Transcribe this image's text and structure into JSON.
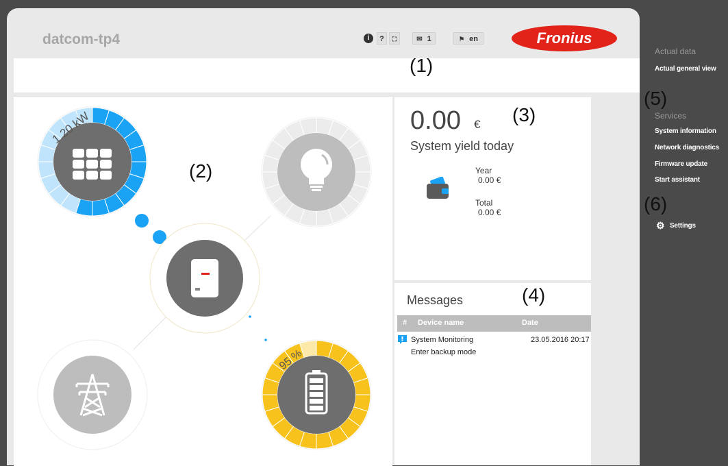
{
  "header": {
    "device_name": "datcom-tp4",
    "info_btn": "i",
    "help_btn": "?",
    "expand_btn": "⛶",
    "mail_count": "1",
    "language": "en",
    "logo_text": "Fronius"
  },
  "annotations": {
    "a1": "(1)",
    "a2": "(2)",
    "a3": "(3)",
    "a4": "(4)",
    "a5": "(5)",
    "a6": "(6)"
  },
  "flow": {
    "pv_power": "1.20 kW",
    "pv_fill_fraction": 0.55,
    "battery_soc": "95 %",
    "battery_fill_fraction": 0.95,
    "icons": [
      "solar-panel-icon",
      "light-bulb-icon",
      "inverter-icon",
      "power-pylon-icon",
      "battery-icon"
    ]
  },
  "yield": {
    "value": "0.00",
    "currency": "€",
    "label": "System yield today",
    "year_label": "Year",
    "year_value": "0.00 €",
    "total_label": "Total",
    "total_value": "0.00 €"
  },
  "messages": {
    "title": "Messages",
    "col_num": "#",
    "col_device": "Device name",
    "col_date": "Date",
    "rows": [
      {
        "device": "System Monitoring",
        "date": "23.05.2016 20:17",
        "text": "Enter backup mode"
      }
    ]
  },
  "sidebar": {
    "actual_data_heading": "Actual data",
    "actual_general_view": "Actual general view",
    "services_heading": "Services",
    "system_information": "System information",
    "network_diagnostics": "Network diagnostics",
    "firmware_update": "Firmware update",
    "start_assistant": "Start assistant",
    "settings": "Settings"
  },
  "colors": {
    "pv_blue": "#1aa3f5",
    "pv_light_blue": "#bfe4fb",
    "battery_yellow": "#f7c21b",
    "battery_light": "#fce9a9",
    "icon_dark": "#6e6e6e",
    "icon_light": "#bdbdbd",
    "fronius_red": "#e2231a"
  }
}
